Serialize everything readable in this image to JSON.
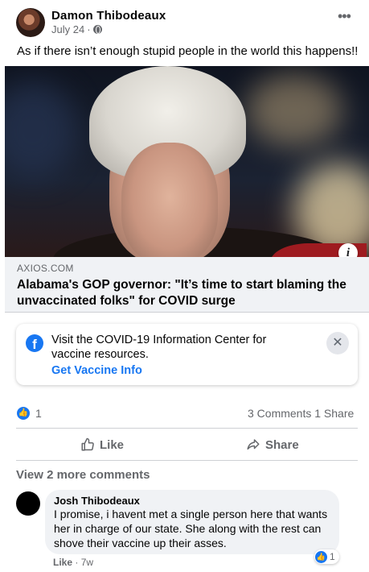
{
  "post": {
    "author": "Damon Thibodeaux",
    "date": "July 24",
    "date_sep": "·",
    "more_icon": "•••",
    "text": "As if there isn’t enough stupid people in the world this happens!!"
  },
  "link": {
    "domain": "AXIOS.COM",
    "headline": "Alabama's GOP governor: \"It’s time to start blaming the unvaccinated folks\" for COVID surge",
    "info_icon": "i"
  },
  "covid_banner": {
    "logo": "f",
    "text": "Visit the COVID-19 Information Center for vaccine resources.",
    "link_label": "Get Vaccine Info",
    "close_icon": "✕"
  },
  "reactions": {
    "like_count": "1",
    "comments": "3 Comments",
    "shares": "1 Share"
  },
  "actions": {
    "like_label": "Like",
    "share_label": "Share"
  },
  "comments": {
    "view_more": "View 2 more comments",
    "items": [
      {
        "author": "Josh Thibodeaux",
        "text": "I promise, i havent met a single person here that wants her in charge of our state. She along with the rest can shove their vaccine up their asses.",
        "reaction_count": "1",
        "like_label": "Like",
        "sep": "·",
        "time": "7w"
      }
    ]
  },
  "colors": {
    "accent": "#1877f2",
    "secondary_text": "#65676b",
    "link_bg": "#f0f2f5"
  }
}
